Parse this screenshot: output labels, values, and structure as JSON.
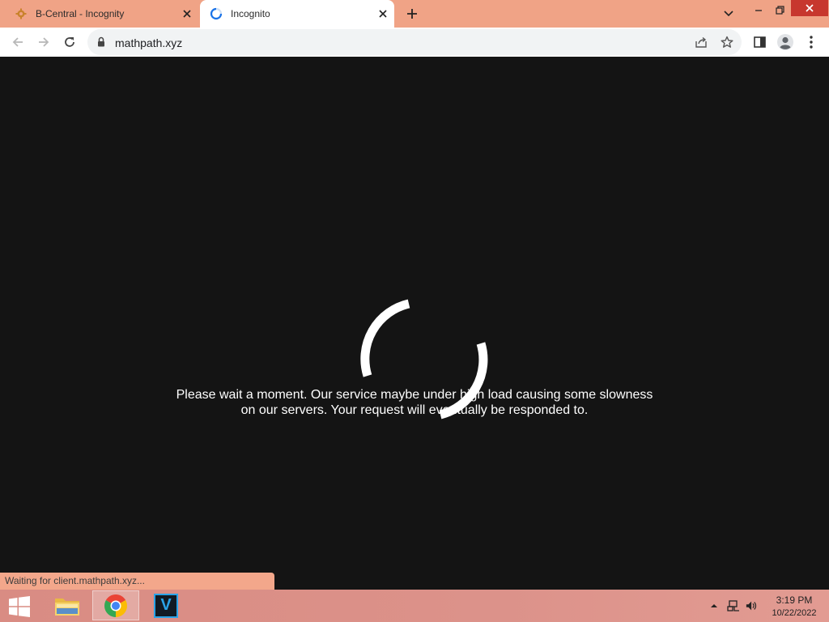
{
  "browser": {
    "tabs": [
      {
        "title": "B-Central - Incognity",
        "icon": "gear-favicon",
        "active": false
      },
      {
        "title": "Incognito",
        "icon": "spinner-favicon",
        "active": true
      }
    ],
    "address_bar": {
      "url": "mathpath.xyz",
      "icon": "lock-icon"
    },
    "toolbar_icons": [
      "back-icon",
      "forward-icon",
      "reload-icon",
      "share-icon",
      "bookmark-star-icon",
      "side-panel-icon",
      "profile-icon",
      "menu-icon"
    ],
    "window_controls": [
      "tab-search-icon",
      "minimize-icon",
      "restore-icon",
      "close-icon"
    ]
  },
  "page": {
    "message_line1": "Please wait a moment. Our service maybe under high load causing some slowness",
    "message_line2": "on our servers. Your request will eventually be responded to.",
    "background_color": "#141414",
    "spinner_color": "#ffffff"
  },
  "status_bar": {
    "text": "Waiting for client.mathpath.xyz..."
  },
  "taskbar": {
    "apps": [
      {
        "name": "File Explorer",
        "icon": "folder-icon"
      },
      {
        "name": "Google Chrome",
        "icon": "chrome-icon",
        "active": true
      },
      {
        "name": "V app",
        "icon": "v-app-icon",
        "label": "V"
      }
    ],
    "tray_icons": [
      "show-hidden-icons",
      "network-icon",
      "volume-icon"
    ],
    "clock": {
      "time": "3:19 PM",
      "date": "10/22/2022"
    }
  },
  "colors": {
    "tab_strip": "#f0a386",
    "toolbar": "#ffffff",
    "omnibox": "#f1f3f4"
  }
}
